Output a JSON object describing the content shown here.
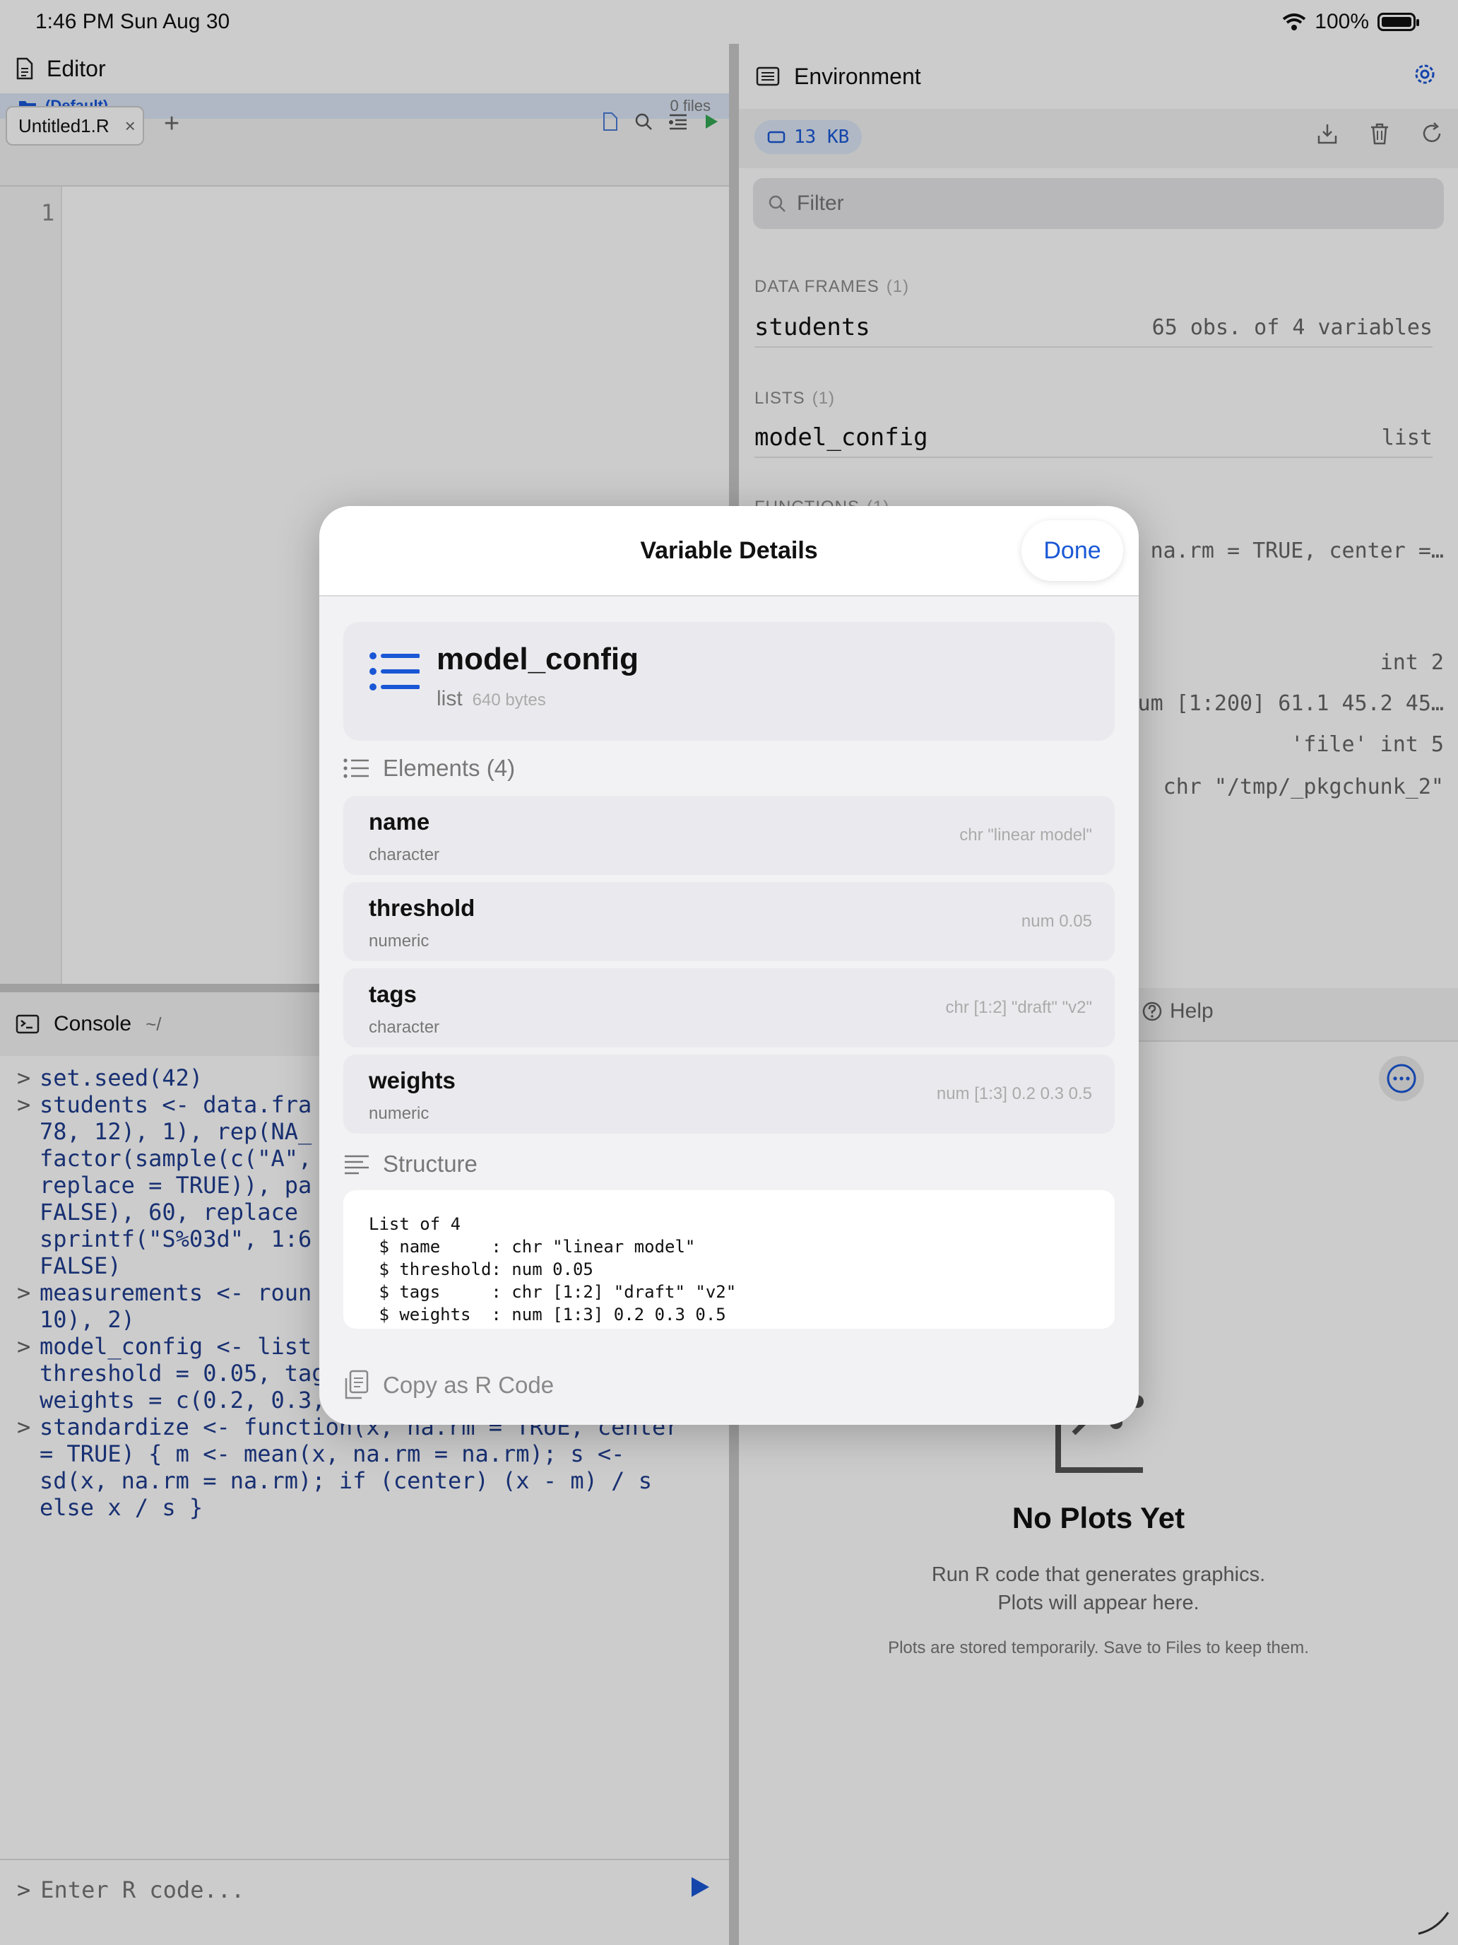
{
  "status": {
    "time": "1:46 PM   Sun Aug 30",
    "battery": "100%"
  },
  "editor": {
    "title": "Editor",
    "folder": "(Default)",
    "file_count": "0 files",
    "tab_name": "Untitled1.R",
    "add_tab": "+",
    "line_number": "1"
  },
  "console": {
    "title": "Console",
    "path": "~/",
    "prompt": ">",
    "lines": [
      {
        "prompt": ">",
        "text": "set.seed(42)"
      },
      {
        "prompt": ">",
        "text": "students <- data.fra"
      },
      {
        "prompt": "",
        "text": "78, 12), 1), rep(NA_"
      },
      {
        "prompt": "",
        "text": "factor(sample(c(\"A\","
      },
      {
        "prompt": "",
        "text": "replace = TRUE)), pa"
      },
      {
        "prompt": "",
        "text": "FALSE), 60, replace"
      },
      {
        "prompt": "",
        "text": "sprintf(\"S%03d\", 1:6"
      },
      {
        "prompt": "",
        "text": "FALSE)"
      },
      {
        "prompt": ">",
        "text": "measurements <- roun"
      },
      {
        "prompt": "",
        "text": "10), 2)"
      },
      {
        "prompt": ">",
        "text": "model_config <- list"
      },
      {
        "prompt": "",
        "text": "threshold = 0.05, tag"
      },
      {
        "prompt": "",
        "text": "weights = c(0.2, 0.3,"
      },
      {
        "prompt": ">",
        "text": "standardize <- function(x, na.rm = TRUE, center"
      },
      {
        "prompt": "",
        "text": "= TRUE) { m <- mean(x, na.rm = na.rm); s <-"
      },
      {
        "prompt": "",
        "text": "sd(x, na.rm = na.rm); if (center) (x - m) / s"
      },
      {
        "prompt": "",
        "text": "else x / s }"
      }
    ],
    "input_placeholder": "Enter R code..."
  },
  "environment": {
    "title": "Environment",
    "memory": "13 KB",
    "filter_placeholder": "Filter",
    "sections": [
      {
        "name": "DATA FRAMES",
        "count": "(1)",
        "rows": [
          {
            "name": "students",
            "value": "65 obs. of 4 variables"
          }
        ]
      },
      {
        "name": "LISTS",
        "count": "(1)",
        "rows": [
          {
            "name": "model_config",
            "value": "list"
          }
        ]
      },
      {
        "name": "FUNCTIONS",
        "count": "(1)"
      }
    ],
    "partial_values": [
      "na.rm = TRUE, center =…",
      "int 2",
      "um [1:200] 61.1 45.2 45…",
      "'file' int 5",
      "chr \"/tmp/_pkgchunk_2\""
    ]
  },
  "plots": {
    "help_tab": "Help",
    "empty_title": "No Plots Yet",
    "empty_line1": "Run R code that generates graphics.",
    "empty_line2": "Plots will appear here.",
    "empty_note": "Plots are stored temporarily. Save to Files to keep them."
  },
  "modal": {
    "title": "Variable Details",
    "done": "Done",
    "var_name": "model_config",
    "var_type": "list",
    "var_size": "640 bytes",
    "elements_title": "Elements (4)",
    "elements": [
      {
        "name": "name",
        "type": "character",
        "value": "chr \"linear model\""
      },
      {
        "name": "threshold",
        "type": "numeric",
        "value": "num 0.05"
      },
      {
        "name": "tags",
        "type": "character",
        "value": "chr [1:2] \"draft\" \"v2\""
      },
      {
        "name": "weights",
        "type": "numeric",
        "value": "num [1:3] 0.2 0.3 0.5"
      }
    ],
    "structure_title": "Structure",
    "structure_text": "List of 4\n $ name     : chr \"linear model\"\n $ threshold: num 0.05\n $ tags     : chr [1:2] \"draft\" \"v2\"\n $ weights  : num [1:3] 0.2 0.3 0.5",
    "copy_label": "Copy as R Code"
  },
  "colors": {
    "accent": "#1a57d6",
    "run_green": "#34a853"
  }
}
